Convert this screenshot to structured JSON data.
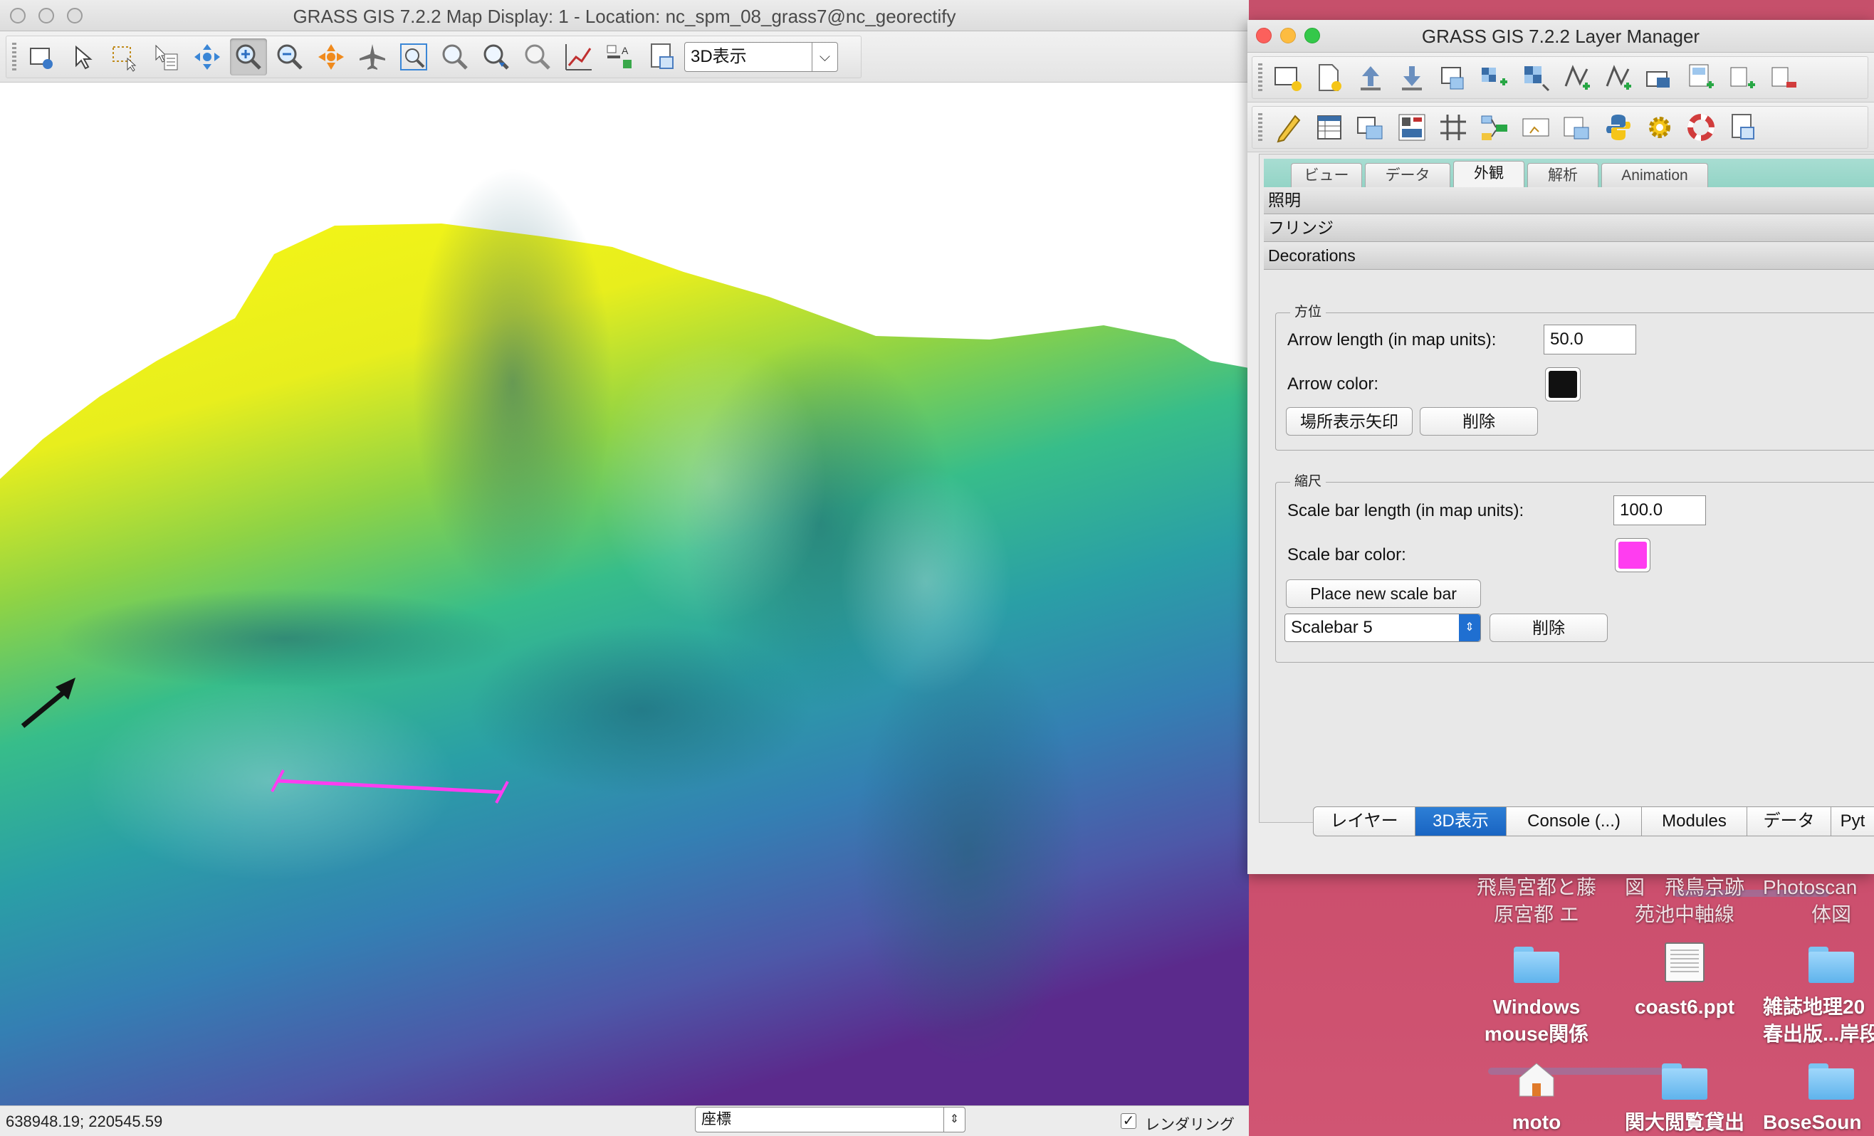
{
  "map_window": {
    "title": "GRASS GIS 7.2.2 Map Display: 1 - Location: nc_spm_08_grass7@nc_georectify",
    "view_mode": "3D表示",
    "status": {
      "coords": "638948.19; 220545.59",
      "mode": "座標",
      "render_label": "レンダリング",
      "render_checked": "✓"
    },
    "toolbar_icons": [
      "display-map-icon",
      "pointer-icon",
      "select-icon",
      "query-icon",
      "pan-icon",
      "zoom-in-icon",
      "zoom-out-icon",
      "zoom-extent-icon",
      "fly-icon",
      "zoom-region-icon",
      "zoom-back-icon",
      "zoom-menu-icon",
      "zoom-last-icon",
      "analyze-icon",
      "overlay-icon",
      "save-icon"
    ]
  },
  "layer_manager": {
    "title": "GRASS GIS 7.2.2 Layer Manager",
    "tabs": [
      "ビュー",
      "データ",
      "外観",
      "解析",
      "Animation"
    ],
    "active_tab": "外観",
    "sections": [
      "照明",
      "フリンジ",
      "Decorations"
    ],
    "north_arrow": {
      "group_label": "方位",
      "length_label": "Arrow length (in map units):",
      "length_value": "50.0",
      "color_label": "Arrow color:",
      "color": "#111111",
      "place_button": "場所表示矢印",
      "delete_button": "削除"
    },
    "scale_bar": {
      "group_label": "縮尺",
      "length_label": "Scale bar length (in map units):",
      "length_value": "100.0",
      "color_label": "Scale bar color:",
      "color": "#ff3df0",
      "place_button": "Place new scale bar",
      "selected": "Scalebar 5",
      "delete_button": "削除"
    },
    "bottom_tabs": [
      "レイヤー",
      "3D表示",
      "Console (...)",
      "Modules",
      "データ",
      "Pyt"
    ],
    "bottom_active": "3D表示"
  },
  "desktop": {
    "top_labels": [
      {
        "line1": "飛鳥宮都と藤",
        "line2": "原宮都 エ"
      },
      {
        "line1": "図　飛鳥京跡",
        "line2": "苑池中軸線"
      },
      {
        "line1": "Photoscan",
        "line2": "体図"
      }
    ],
    "icons": [
      {
        "line1": "Windows",
        "line2": "mouse関係"
      },
      {
        "line1": "coast6.ppt",
        "line2": ""
      },
      {
        "line1": "雑誌地理20",
        "line2": "春出版...岸段"
      },
      {
        "line1": "moto",
        "line2": ""
      },
      {
        "line1": "関大閲覧貸出",
        "line2": ""
      },
      {
        "line1": "BoseSoun",
        "line2": ""
      }
    ]
  },
  "colors": {
    "terrain_high": "#f2f21a",
    "terrain_mid": "#2bb3a0",
    "terrain_low": "#5a2b8f",
    "scale_bar": "#ff3df0",
    "active_tab": "#1964c2"
  }
}
